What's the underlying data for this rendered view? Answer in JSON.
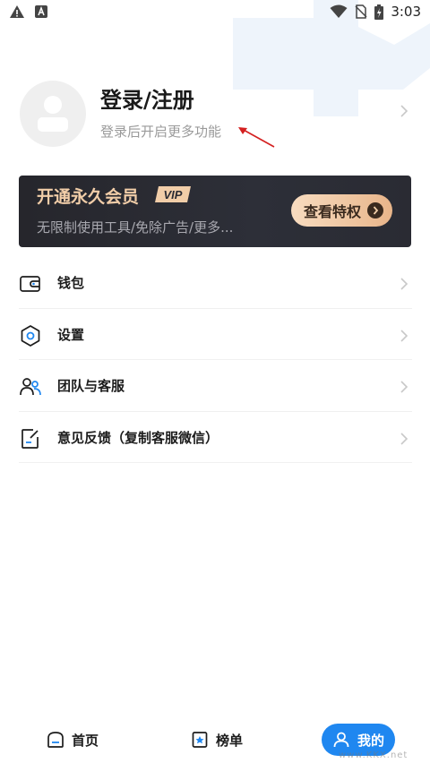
{
  "status_bar": {
    "time": "3:03",
    "left_icons": [
      "warning-icon",
      "text-icon"
    ],
    "right_icons": [
      "wifi-icon",
      "no-sim-icon",
      "battery-icon"
    ]
  },
  "profile": {
    "title": "登录/注册",
    "subtitle": "登录后开启更多功能"
  },
  "vip": {
    "title": "开通永久会员",
    "badge": "VIP",
    "description": "无限制使用工具/免除广告/更多...",
    "button_label": "查看特权"
  },
  "menu": {
    "items": [
      {
        "label": "钱包",
        "icon": "wallet-icon"
      },
      {
        "label": "设置",
        "icon": "settings-icon"
      },
      {
        "label": "团队与客服",
        "icon": "team-icon"
      },
      {
        "label": "意见反馈（复制客服微信）",
        "icon": "feedback-icon"
      }
    ]
  },
  "bottom_nav": {
    "items": [
      {
        "label": "首页",
        "icon": "home-icon"
      },
      {
        "label": "榜单",
        "icon": "ranking-icon"
      },
      {
        "label": "我的",
        "icon": "profile-icon",
        "active": true
      }
    ]
  },
  "watermark": {
    "text": "www.KKX.net"
  },
  "colors": {
    "accent": "#1f87f0",
    "vip_gold": "#f1cda8",
    "vip_bg": "#2a2b33",
    "annotation_red": "#d42020"
  }
}
